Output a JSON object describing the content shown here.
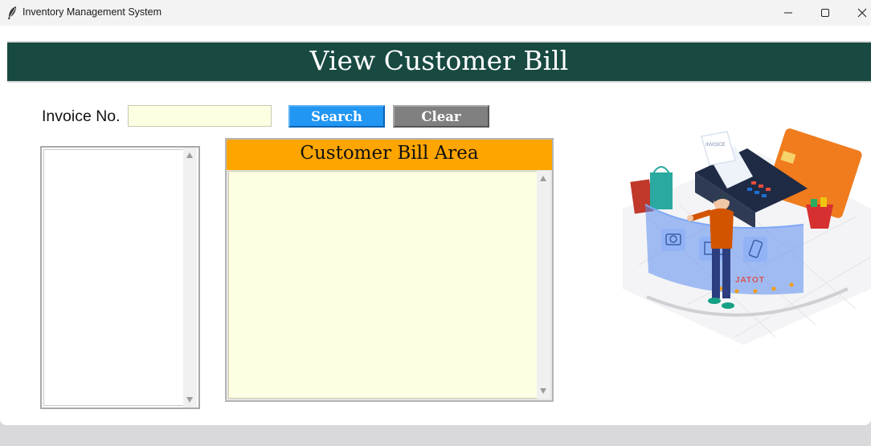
{
  "window": {
    "title": "Inventory Management System"
  },
  "header": {
    "title": "View Customer Bill"
  },
  "search": {
    "label": "Invoice No.",
    "value": "",
    "search_button": "Search",
    "clear_button": "Clear"
  },
  "bill_area": {
    "title": "Customer Bill Area",
    "content": ""
  },
  "illustration": {
    "sign_text": "JATOT",
    "receipt_text": "INVOICE"
  },
  "colors": {
    "header_bg": "#184a42",
    "search_btn": "#2196f3",
    "clear_btn": "#808080",
    "bill_header": "#ffa500",
    "input_bg": "#fefee3"
  },
  "icons": [
    "feather-icon",
    "minimize-icon",
    "maximize-icon",
    "close-icon",
    "scroll-up-arrow-icon",
    "scroll-down-arrow-icon"
  ]
}
